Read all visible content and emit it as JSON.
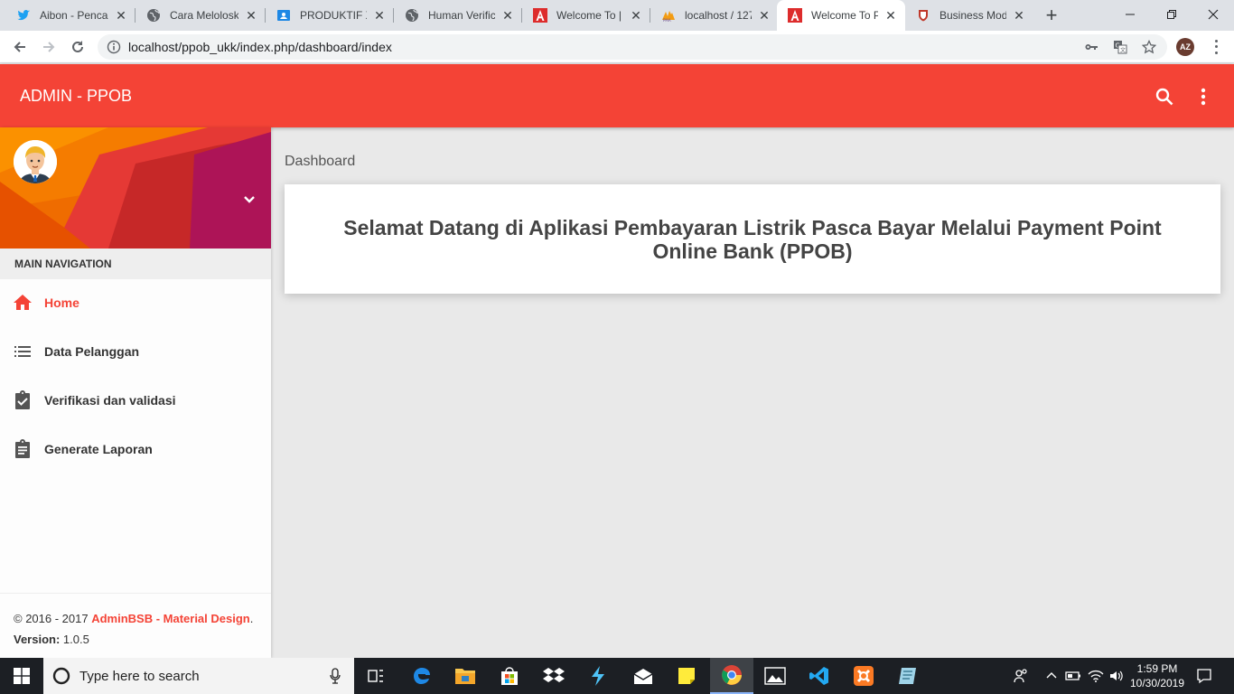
{
  "browser": {
    "tabs": [
      {
        "title": "Aibon - Pencari",
        "icon": "twitter-icon"
      },
      {
        "title": "Cara Meloloskan",
        "icon": "globe-icon"
      },
      {
        "title": "PRODUKTIF XII",
        "icon": "classroom-icon"
      },
      {
        "title": "Human Verification",
        "icon": "globe-icon"
      },
      {
        "title": "Welcome To | A",
        "icon": "angular-icon"
      },
      {
        "title": "localhost / 127",
        "icon": "phpmyadmin-icon"
      },
      {
        "title": "Welcome To PPOB",
        "icon": "angular-icon",
        "active": true
      },
      {
        "title": "Business Model",
        "icon": "shield-icon"
      }
    ],
    "url": "localhost/ppob_ukk/index.php/dashboard/index",
    "profile_initials": "AZ"
  },
  "app": {
    "brand": "ADMIN - PPOB",
    "accent_color": "#f44336"
  },
  "sidebar": {
    "menu_header": "MAIN NAVIGATION",
    "items": [
      {
        "label": "Home",
        "icon": "home-icon",
        "active": true
      },
      {
        "label": "Data Pelanggan",
        "icon": "list-icon"
      },
      {
        "label": "Verifikasi dan validasi",
        "icon": "assignment-check-icon"
      },
      {
        "label": "Generate Laporan",
        "icon": "assignment-icon"
      }
    ],
    "footer": {
      "copyright_prefix": "© 2016 - 2017 ",
      "brand_link": "AdminBSB - Material Design",
      "period": ".",
      "version_label": "Version:",
      "version_value": " 1.0.5"
    }
  },
  "content": {
    "page_title": "Dashboard",
    "welcome": "Selamat Datang di Aplikasi Pembayaran Listrik Pasca Bayar Melalui Payment Point Online Bank (PPOB)"
  },
  "taskbar": {
    "search_placeholder": "Type here to search",
    "time": "1:59 PM",
    "date": "10/30/2019"
  }
}
